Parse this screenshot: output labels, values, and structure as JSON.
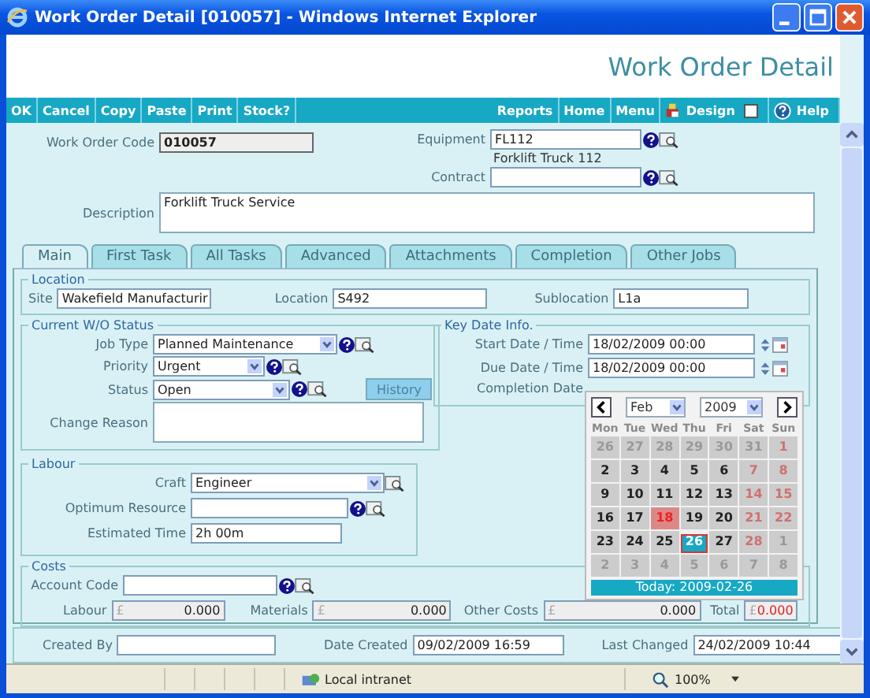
{
  "window": {
    "title": "Work Order Detail [010057] - Windows Internet Explorer"
  },
  "page_title": "Work Order Detail",
  "toolbar": {
    "left": [
      "OK",
      "Cancel",
      "Copy",
      "Paste",
      "Print",
      "Stock?"
    ],
    "right": [
      {
        "label": "Reports",
        "kind": "link"
      },
      {
        "label": "Home",
        "kind": "link"
      },
      {
        "label": "Menu",
        "kind": "link"
      },
      {
        "label": "Design",
        "kind": "checkbox",
        "checked": false
      },
      {
        "label": "Help",
        "kind": "help"
      }
    ]
  },
  "header": {
    "work_order_code": {
      "label": "Work Order Code",
      "value": "010057",
      "kind": "readonly"
    },
    "equipment": {
      "label": "Equipment",
      "value": "FL112",
      "kind": "text",
      "help": true,
      "lookup": true
    },
    "equipment_name": "Forklift Truck 112",
    "contract": {
      "label": "Contract",
      "kind": "text",
      "help": true,
      "lookup": true
    },
    "description": {
      "label": "Description",
      "value": "Forklift Truck Service",
      "kind": "textarea"
    }
  },
  "tabs": [
    {
      "label": "Main",
      "selected": true
    },
    {
      "label": "First Task",
      "selected": false
    },
    {
      "label": "All Tasks",
      "selected": false
    },
    {
      "label": "Advanced",
      "selected": false
    },
    {
      "label": "Attachments",
      "selected": false
    },
    {
      "label": "Completion",
      "selected": false
    },
    {
      "label": "Other Jobs",
      "selected": false
    }
  ],
  "location": {
    "legend": "Location",
    "fields": [
      {
        "label": "Site",
        "value": "Wakefield Manufacturir",
        "kind": "text"
      },
      {
        "label": "Location",
        "value": "S492",
        "kind": "text"
      },
      {
        "label": "Sublocation",
        "value": "L1a",
        "kind": "text"
      }
    ]
  },
  "status": {
    "legend": "Current W/O Status",
    "fields": [
      {
        "label": "Job Type",
        "value": "Planned Maintenance",
        "kind": "select",
        "help": true,
        "lookup": true
      },
      {
        "label": "Priority",
        "value": "Urgent",
        "kind": "select",
        "help": true,
        "lookup": true
      },
      {
        "label": "Status",
        "value": "Open",
        "kind": "select",
        "help": true,
        "lookup": true
      },
      {
        "label": "Change Reason",
        "kind": "textarea"
      }
    ],
    "history_button": {
      "label": "History",
      "disabled": true
    }
  },
  "key_dates": {
    "legend": "Key Date Info.",
    "fields": [
      {
        "label": "Start Date / Time",
        "value": "18/02/2009 00:00",
        "kind": "datetime"
      },
      {
        "label": "Due Date / Time",
        "value": "18/02/2009 00:00",
        "kind": "datetime"
      },
      {
        "label": "Completion Date"
      }
    ]
  },
  "labour": {
    "legend": "Labour",
    "fields": [
      {
        "label": "Craft",
        "value": "Engineer",
        "kind": "select",
        "lookup": true
      },
      {
        "label": "Optimum Resource",
        "kind": "text",
        "help": true,
        "lookup": true
      },
      {
        "label": "Estimated Time",
        "value": "2h 00m",
        "kind": "text"
      }
    ]
  },
  "costs": {
    "legend": "Costs",
    "account_code": {
      "label": "Account Code",
      "kind": "text",
      "help": true,
      "lookup": true
    },
    "amounts": [
      {
        "label": "Labour",
        "currency": "£",
        "value": "0.000",
        "kind": "money",
        "highlight": false
      },
      {
        "label": "Materials",
        "currency": "£",
        "value": "0.000",
        "kind": "money",
        "highlight": false
      },
      {
        "label": "Other Costs",
        "currency": "£",
        "value": "0.000",
        "kind": "money",
        "highlight": false
      },
      {
        "label": "Total",
        "currency": "£",
        "value": "0.000",
        "kind": "money",
        "highlight": true
      }
    ]
  },
  "audit": [
    {
      "label": "Created By",
      "kind": "text"
    },
    {
      "label": "Date Created",
      "value": "09/02/2009 16:59",
      "kind": "text"
    },
    {
      "label": "Last Changed",
      "value": "24/02/2009 10:44",
      "kind": "text"
    }
  ],
  "calendar": {
    "month": "Feb",
    "year": "2009",
    "weekdays": [
      "Mon",
      "Tue",
      "Wed",
      "Thu",
      "Fri",
      "Sat",
      "Sun"
    ],
    "weeks": [
      [
        {
          "day": "26",
          "kind": "other"
        },
        {
          "day": "27",
          "kind": "other"
        },
        {
          "day": "28",
          "kind": "other"
        },
        {
          "day": "29",
          "kind": "other"
        },
        {
          "day": "30",
          "kind": "other"
        },
        {
          "day": "31",
          "kind": "other"
        },
        {
          "day": "1",
          "kind": "weekend"
        }
      ],
      [
        {
          "day": "2",
          "kind": "day"
        },
        {
          "day": "3",
          "kind": "day"
        },
        {
          "day": "4",
          "kind": "day"
        },
        {
          "day": "5",
          "kind": "day"
        },
        {
          "day": "6",
          "kind": "day"
        },
        {
          "day": "7",
          "kind": "weekend"
        },
        {
          "day": "8",
          "kind": "weekend"
        }
      ],
      [
        {
          "day": "9",
          "kind": "day"
        },
        {
          "day": "10",
          "kind": "day"
        },
        {
          "day": "11",
          "kind": "day"
        },
        {
          "day": "12",
          "kind": "day"
        },
        {
          "day": "13",
          "kind": "day"
        },
        {
          "day": "14",
          "kind": "weekend"
        },
        {
          "day": "15",
          "kind": "weekend"
        }
      ],
      [
        {
          "day": "16",
          "kind": "day"
        },
        {
          "day": "17",
          "kind": "day"
        },
        {
          "day": "18",
          "kind": "selected"
        },
        {
          "day": "19",
          "kind": "day"
        },
        {
          "day": "20",
          "kind": "day"
        },
        {
          "day": "21",
          "kind": "weekend"
        },
        {
          "day": "22",
          "kind": "weekend"
        }
      ],
      [
        {
          "day": "23",
          "kind": "day"
        },
        {
          "day": "24",
          "kind": "day"
        },
        {
          "day": "25",
          "kind": "day"
        },
        {
          "day": "26",
          "kind": "today"
        },
        {
          "day": "27",
          "kind": "day"
        },
        {
          "day": "28",
          "kind": "weekend"
        },
        {
          "day": "1",
          "kind": "other"
        }
      ],
      [
        {
          "day": "2",
          "kind": "other"
        },
        {
          "day": "3",
          "kind": "other"
        },
        {
          "day": "4",
          "kind": "other"
        },
        {
          "day": "5",
          "kind": "other"
        },
        {
          "day": "6",
          "kind": "other"
        },
        {
          "day": "7",
          "kind": "other"
        },
        {
          "day": "8",
          "kind": "other"
        }
      ]
    ],
    "today_label": "Today: 2009-02-26"
  },
  "status_bar": {
    "zone": "Local intranet",
    "zoom": "100%"
  }
}
